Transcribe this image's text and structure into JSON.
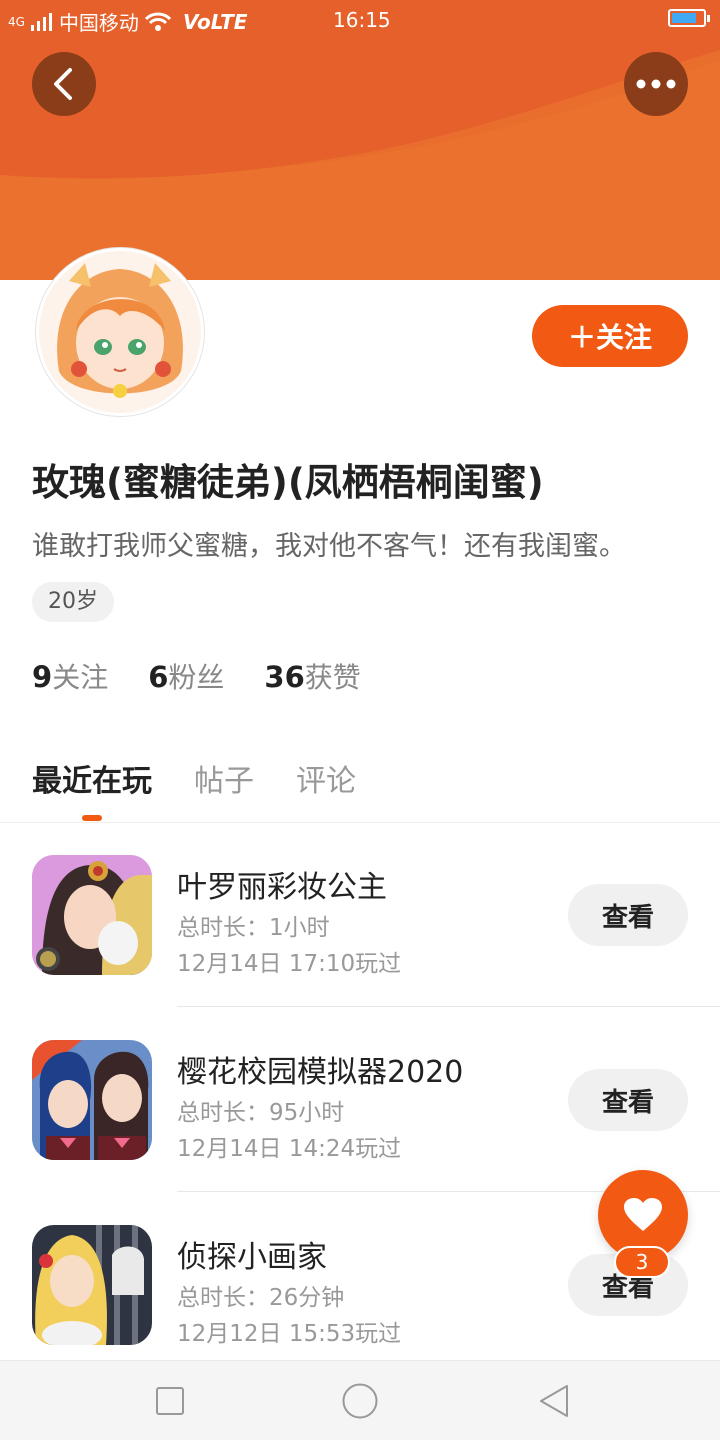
{
  "status_bar": {
    "signal": "4G",
    "carrier": "中国移动",
    "volte": "VoLTE",
    "time": "16:15",
    "battery_level": 0.8
  },
  "header": {
    "back_icon": "chevron-left-icon",
    "more_icon": "more-dots-icon"
  },
  "profile": {
    "follow_label": "＋关注",
    "name": "玫瑰(蜜糖徒弟)(凤栖梧桐闺蜜)",
    "bio": "谁敢打我师父蜜糖，我对他不客气！还有我闺蜜。",
    "age_tag": "20岁",
    "stats": [
      {
        "value": "9",
        "label": "关注"
      },
      {
        "value": "6",
        "label": "粉丝"
      },
      {
        "value": "36",
        "label": "获赞"
      }
    ]
  },
  "tabs": [
    {
      "label": "最近在玩",
      "active": true
    },
    {
      "label": "帖子",
      "active": false
    },
    {
      "label": "评论",
      "active": false
    }
  ],
  "games": [
    {
      "title": "叶罗丽彩妆公主",
      "duration": "总时长：1小时",
      "last_played": "12月14日 17:10玩过",
      "button": "查看"
    },
    {
      "title": "樱花校园模拟器2020",
      "duration": "总时长：95小时",
      "last_played": "12月14日 14:24玩过",
      "button": "查看"
    },
    {
      "title": "侦探小画家",
      "duration": "总时长：26分钟",
      "last_played": "12月12日 15:53玩过",
      "button": "查看"
    }
  ],
  "fab": {
    "icon": "heart-icon",
    "badge": "3"
  },
  "navbar": {
    "icons": [
      "recent-apps-icon",
      "home-icon",
      "back-triangle-icon"
    ]
  },
  "colors": {
    "accent": "#f25a14",
    "banner": "#e8692e"
  }
}
